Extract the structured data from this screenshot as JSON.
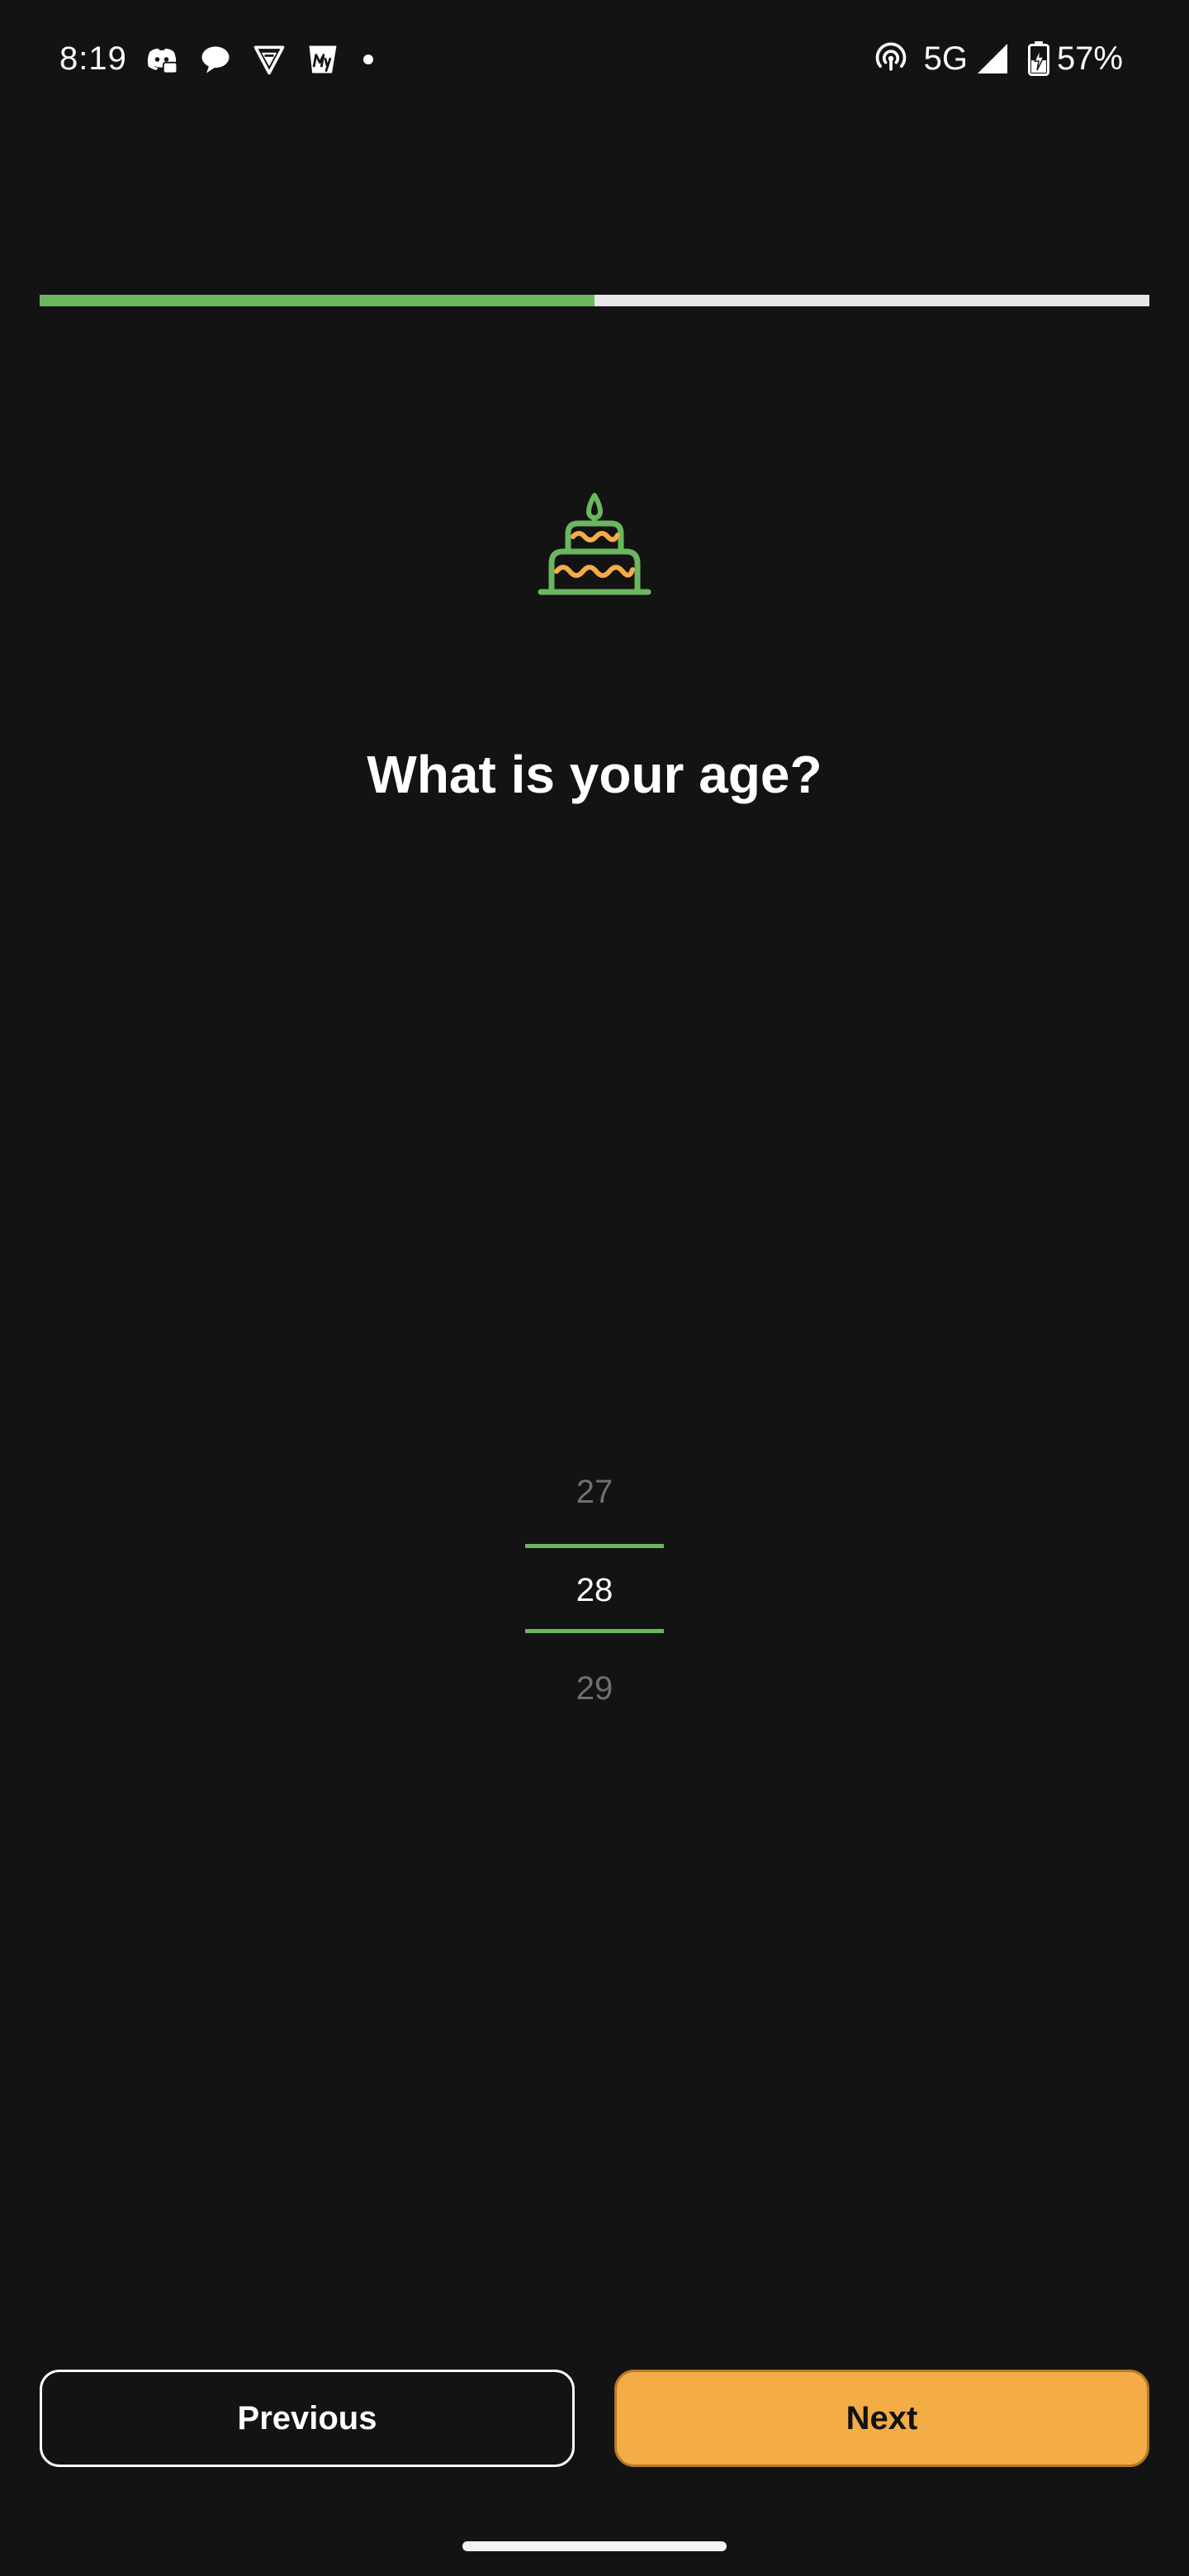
{
  "status_bar": {
    "time": "8:19",
    "notification_icons": [
      "discord-icon",
      "chat-bubble-icon",
      "vpn-shield-icon",
      "myntra-icon"
    ],
    "network": "5G",
    "battery": "57%"
  },
  "progress": {
    "fraction": 0.5,
    "fill_color": "#6bb65f",
    "track_color": "#e9e6ea"
  },
  "header": {
    "icon": "birthday-cake-icon",
    "question": "What is your age?"
  },
  "age_picker": {
    "previous": "27",
    "selected": "28",
    "next": "29",
    "accent_color": "#6bb65f"
  },
  "actions": {
    "previous_label": "Previous",
    "next_label": "Next",
    "next_color": "#f3ac46"
  },
  "colors": {
    "background": "#131313",
    "cake_green": "#6bb65f",
    "cake_orange": "#f3ac46"
  }
}
